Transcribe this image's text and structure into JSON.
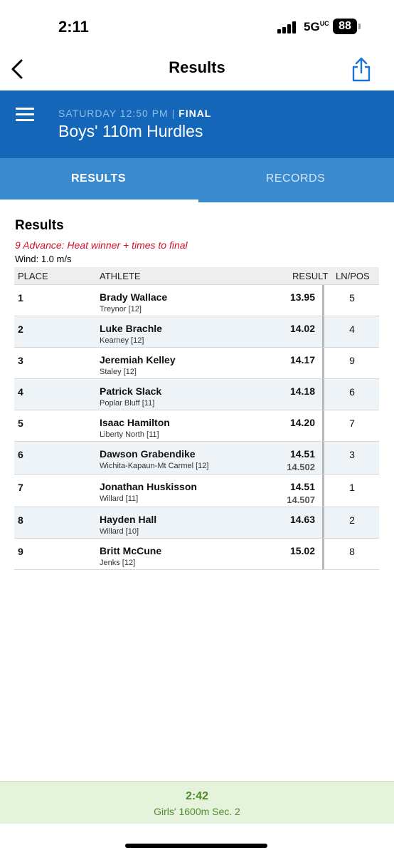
{
  "status_bar": {
    "time": "2:11",
    "network": "5G",
    "battery": "88"
  },
  "nav": {
    "title": "Results"
  },
  "event": {
    "day_time": "SATURDAY 12:50 PM",
    "separator": "|",
    "status": "FINAL",
    "name": "Boys' 110m Hurdles"
  },
  "tabs": [
    {
      "label": "RESULTS",
      "active": true
    },
    {
      "label": "RECORDS",
      "active": false
    }
  ],
  "results": {
    "heading": "Results",
    "advance_note": "9 Advance: Heat winner + times to final",
    "wind": "Wind: 1.0 m/s",
    "columns": {
      "place": "PLACE",
      "athlete": "ATHLETE",
      "result": "RESULT",
      "lane": "LN/POS"
    },
    "rows": [
      {
        "place": "1",
        "name": "Brady Wallace",
        "team": "Treynor [12]",
        "result": "13.95",
        "sub_result": "",
        "lane": "5"
      },
      {
        "place": "2",
        "name": "Luke Brachle",
        "team": "Kearney [12]",
        "result": "14.02",
        "sub_result": "",
        "lane": "4"
      },
      {
        "place": "3",
        "name": "Jeremiah Kelley",
        "team": "Staley [12]",
        "result": "14.17",
        "sub_result": "",
        "lane": "9"
      },
      {
        "place": "4",
        "name": "Patrick Slack",
        "team": "Poplar Bluff [11]",
        "result": "14.18",
        "sub_result": "",
        "lane": "6"
      },
      {
        "place": "5",
        "name": "Isaac Hamilton",
        "team": "Liberty North [11]",
        "result": "14.20",
        "sub_result": "",
        "lane": "7"
      },
      {
        "place": "6",
        "name": "Dawson Grabendike",
        "team": "Wichita-Kapaun-Mt Carmel [12]",
        "result": "14.51",
        "sub_result": "14.502",
        "lane": "3"
      },
      {
        "place": "7",
        "name": "Jonathan Huskisson",
        "team": "Willard [11]",
        "result": "14.51",
        "sub_result": "14.507",
        "lane": "1"
      },
      {
        "place": "8",
        "name": "Hayden Hall",
        "team": "Willard [10]",
        "result": "14.63",
        "sub_result": "",
        "lane": "2"
      },
      {
        "place": "9",
        "name": "Britt McCune",
        "team": "Jenks [12]",
        "result": "15.02",
        "sub_result": "",
        "lane": "8"
      }
    ]
  },
  "next_event": {
    "time": "2:42",
    "name": "Girls' 1600m Sec. 2"
  },
  "colors": {
    "header_blue": "#1466b8",
    "tab_blue": "#3a8ad0",
    "advance_red": "#d0142c",
    "banner_green": "#4e8b2a"
  }
}
